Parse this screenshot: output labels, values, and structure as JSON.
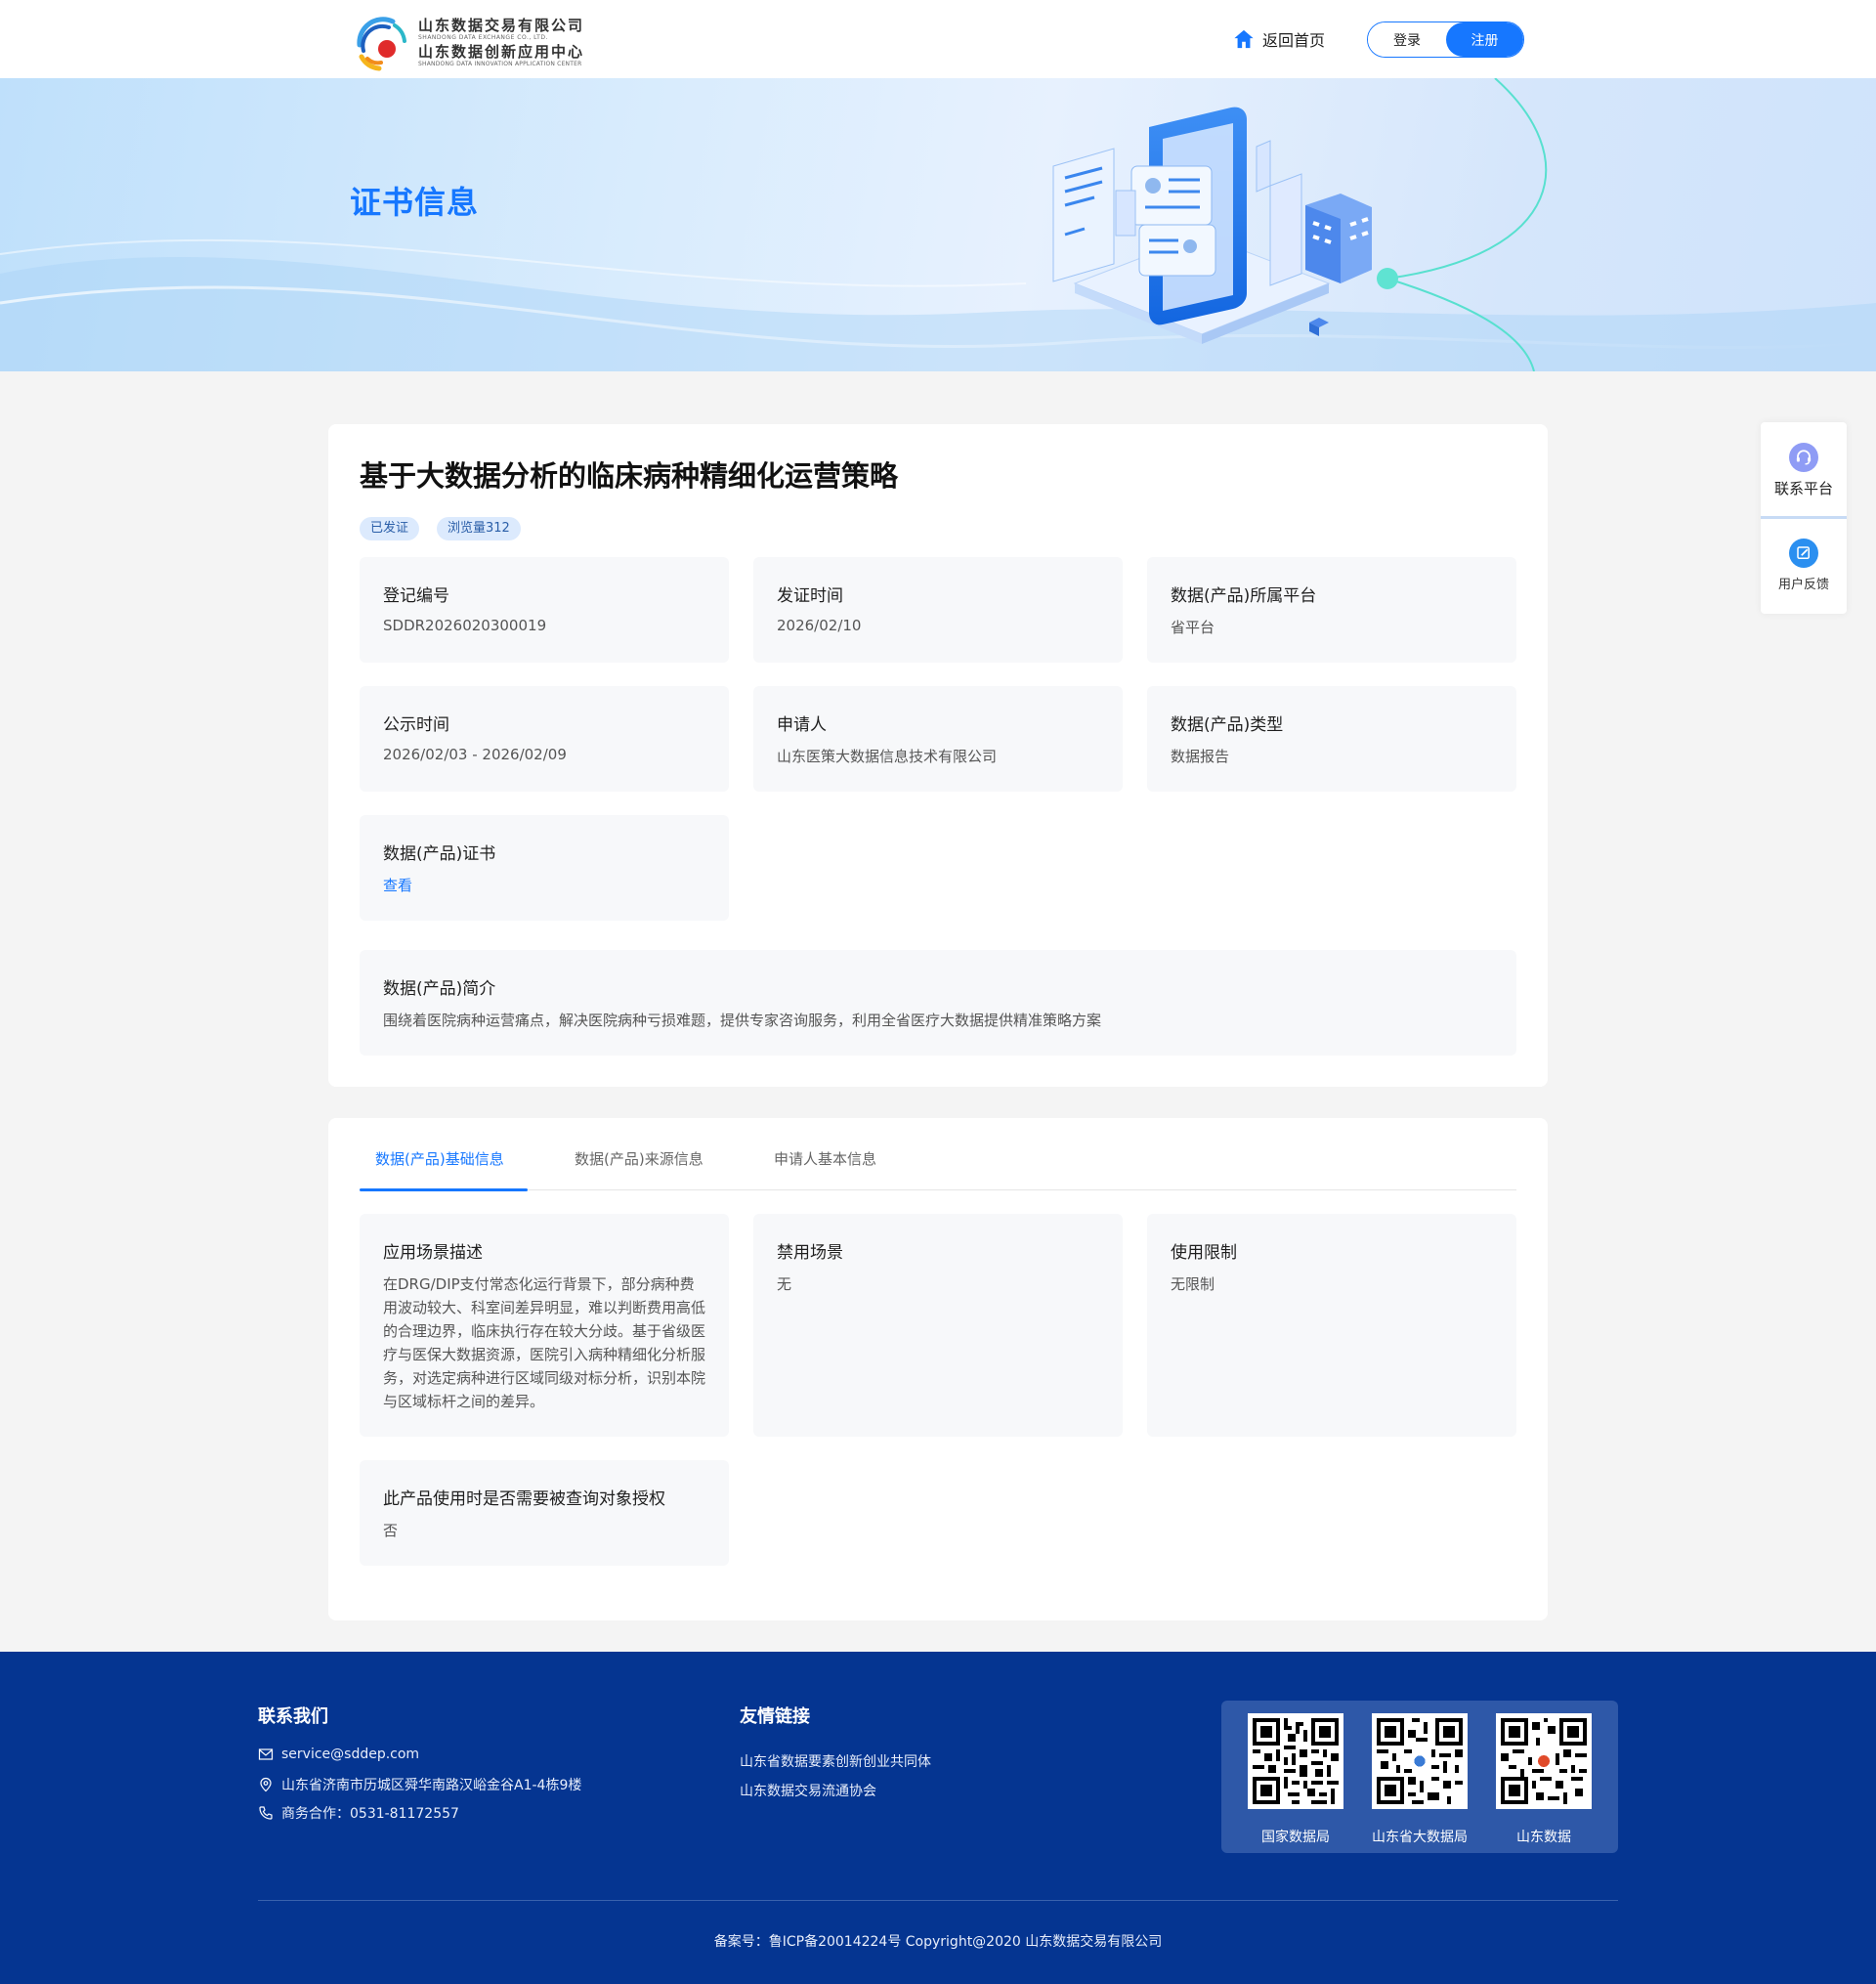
{
  "header": {
    "logo": {
      "line1": "山东数据交易有限公司",
      "line1_en": "SHANDONG DATA EXCHANGE CO., LTD.",
      "line2": "山东数据创新应用中心",
      "line2_en": "SHANDONG DATA INNOVATION APPLICATION CENTER"
    },
    "home_label": "返回首页",
    "login_label": "登录",
    "register_label": "注册"
  },
  "banner": {
    "title": "证书信息"
  },
  "product": {
    "title": "基于大数据分析的临床病种精细化运营策略",
    "tags": [
      "已发证",
      "浏览量312"
    ],
    "fields": [
      {
        "key": "登记编号",
        "value": "SDDR2026020300019"
      },
      {
        "key": "发证时间",
        "value": "2026/02/10"
      },
      {
        "key": "数据(产品)所属平台",
        "value": "省平台"
      },
      {
        "key": "公示时间",
        "value": "2026/02/03 - 2026/02/09"
      },
      {
        "key": "申请人",
        "value": "山东医策大数据信息技术有限公司"
      },
      {
        "key": "数据(产品)类型",
        "value": "数据报告"
      },
      {
        "key": "数据(产品)证书",
        "value": "查看"
      }
    ],
    "intro": {
      "key": "数据(产品)简介",
      "value": "围绕着医院病种运营痛点，解决医院病种亏损难题，提供专家咨询服务，利用全省医疗大数据提供精准策略方案"
    }
  },
  "tabs": {
    "items": [
      "数据(产品)基础信息",
      "数据(产品)来源信息",
      "申请人基本信息"
    ],
    "active_index": 0
  },
  "basic_info": [
    {
      "key": "应用场景描述",
      "value": "在DRG/DIP支付常态化运行背景下，部分病种费用波动较大、科室间差异明显，难以判断费用高低的合理边界，临床执行存在较大分歧。基于省级医疗与医保大数据资源，医院引入病种精细化分析服务，对选定病种进行区域同级对标分析，识别本院与区域标杆之间的差异。"
    },
    {
      "key": "禁用场景",
      "value": "无"
    },
    {
      "key": "使用限制",
      "value": "无限制"
    },
    {
      "key": "此产品使用时是否需要被查询对象授权",
      "value": "否"
    }
  ],
  "side": {
    "contact_label": "联系平台",
    "feedback_label": "用户反馈"
  },
  "footer": {
    "contact_title": "联系我们",
    "email": "service@sddep.com",
    "address": "山东省济南市历城区舜华南路汉峪金谷A1-4栋9楼",
    "phone": "商务合作：0531-81172557",
    "links_title": "友情链接",
    "links": [
      "山东省数据要素创新创业共同体",
      "山东数据交易流通协会"
    ],
    "qrcodes": [
      "国家数据局",
      "山东省大数据局",
      "山东数据"
    ],
    "copyright": "备案号：鲁ICP备20014224号 Copyright@2020 山东数据交易有限公司"
  },
  "colors": {
    "primary": "#1677ff",
    "footer_bg": "#053591",
    "page_bg": "#f4f4f4"
  }
}
